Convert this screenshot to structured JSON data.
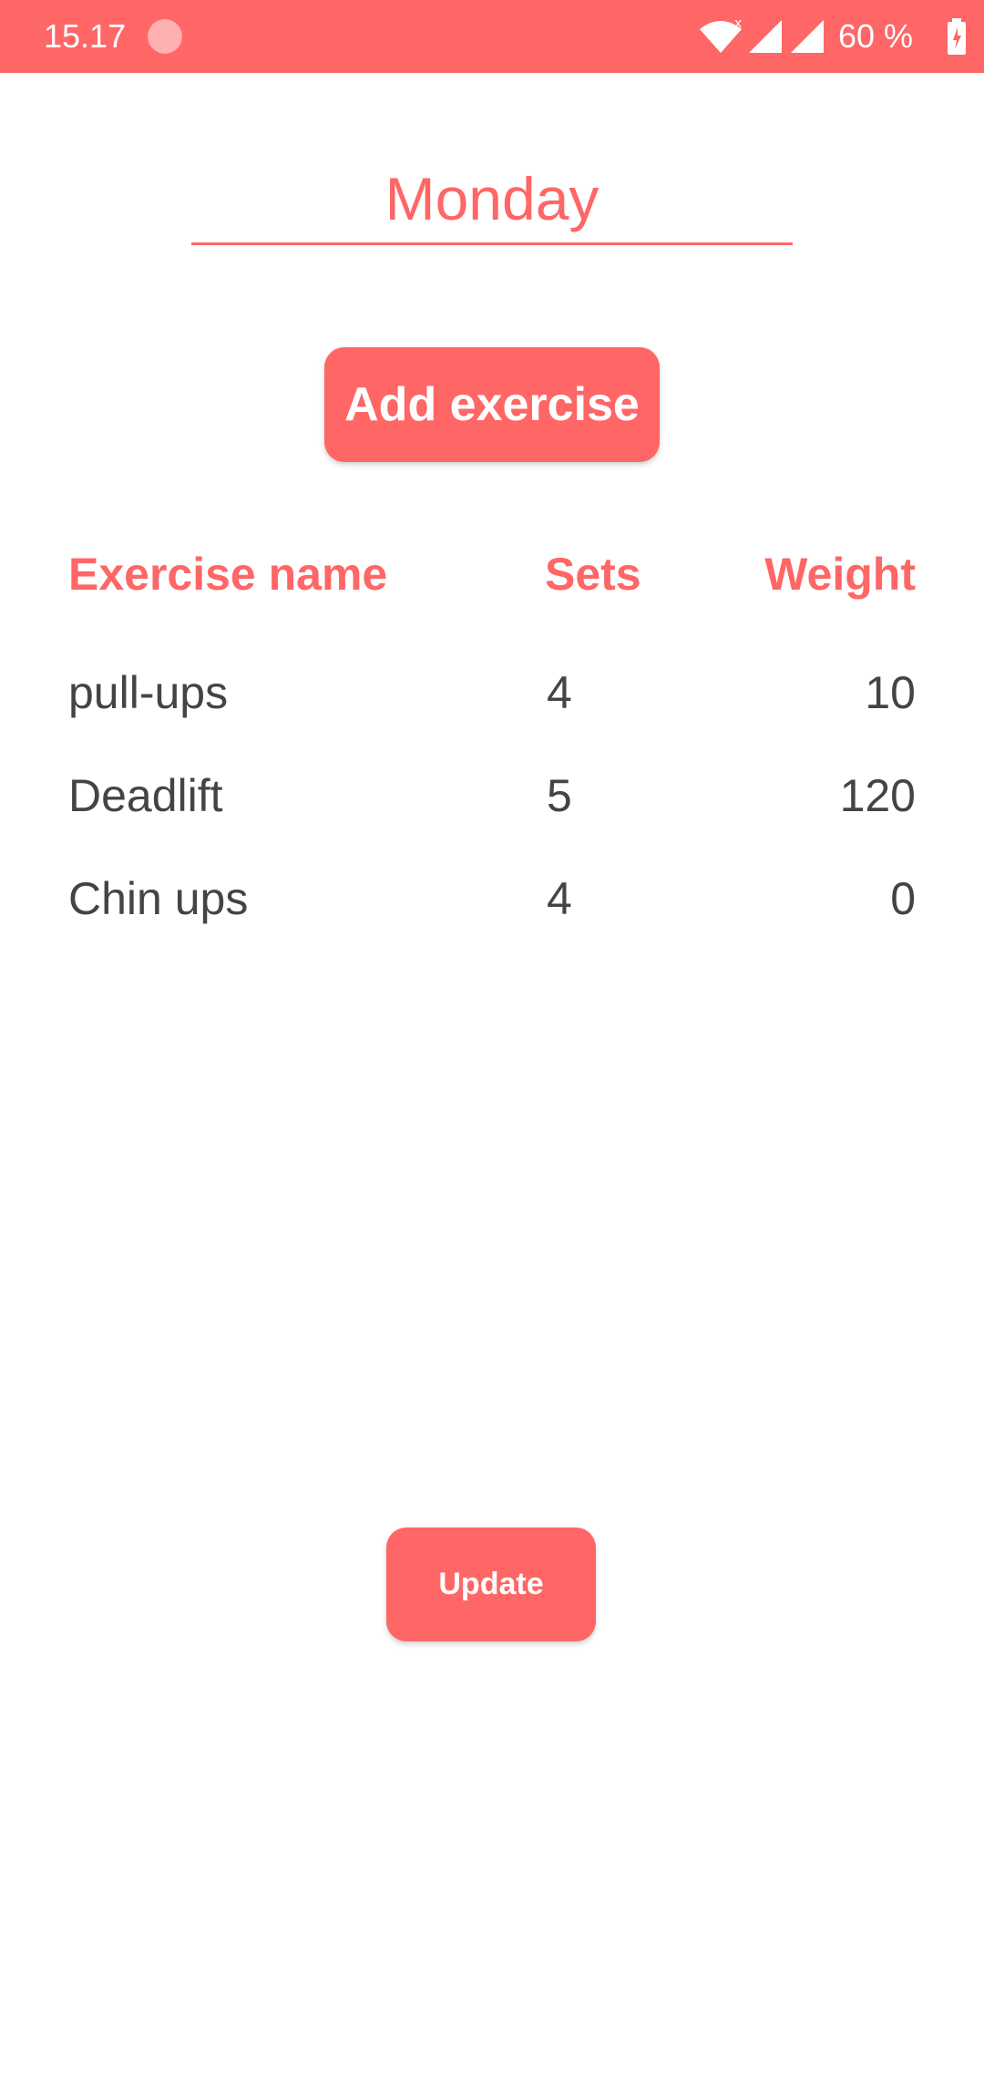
{
  "status_bar": {
    "time": "15.17",
    "battery": "60 %",
    "color": "#ff6666"
  },
  "day": {
    "title": "Monday"
  },
  "buttons": {
    "add_exercise": "Add exercise",
    "update": "Update"
  },
  "table": {
    "headers": [
      "Exercise name",
      "Sets",
      "Weight"
    ],
    "rows": [
      {
        "name": "pull-ups",
        "sets": "4",
        "weight": "10"
      },
      {
        "name": "Deadlift",
        "sets": "5",
        "weight": "120"
      },
      {
        "name": "Chin ups",
        "sets": "4",
        "weight": "0"
      }
    ]
  },
  "theme": {
    "accent": "#ff6666",
    "text": "#444444"
  }
}
